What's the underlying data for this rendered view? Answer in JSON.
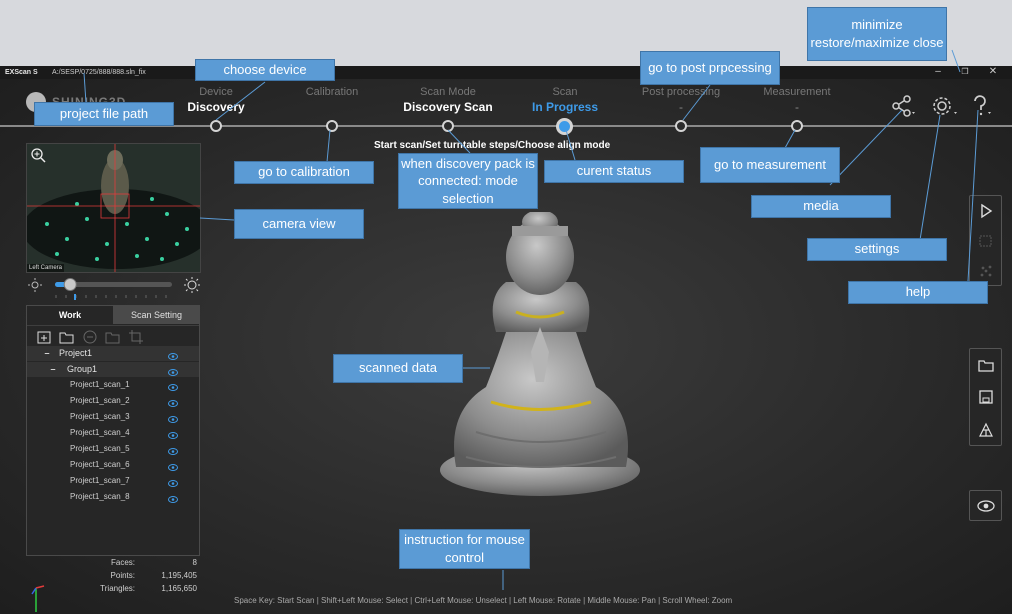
{
  "window": {
    "app_name": "EXScan S",
    "file_path": "A:/SESP/0725/888/888.sln_fix",
    "minimize": "–",
    "restore": "❐",
    "close": "✕"
  },
  "logo": {
    "text": "SHINING3D",
    "icon": "shining3d-logo-icon"
  },
  "steps": [
    {
      "title": "Device",
      "value": "Discovery"
    },
    {
      "title": "Calibration",
      "value": ""
    },
    {
      "title": "Scan Mode",
      "value": "Discovery Scan"
    },
    {
      "title": "Scan",
      "value": "In Progress"
    },
    {
      "title": "Post processing",
      "value": "-"
    },
    {
      "title": "Measurement",
      "value": "-"
    }
  ],
  "status_text": "Start scan/Set turntable steps/Choose align mode",
  "top_icons": [
    "share-icon",
    "gear-icon",
    "help-icon"
  ],
  "camera": {
    "label": "Left Camera",
    "zoom_icon": "zoom-in-icon"
  },
  "brightness": {
    "level": 0.13
  },
  "panel": {
    "tabs": [
      "Work",
      "Scan Setting"
    ],
    "tools": [
      "new-group-icon",
      "open-folder-icon",
      "remove-icon",
      "folder-icon",
      "crop-icon"
    ],
    "project": "Project1",
    "group": "Group1",
    "scans": [
      "Project1_scan_1",
      "Project1_scan_2",
      "Project1_scan_3",
      "Project1_scan_4",
      "Project1_scan_5",
      "Project1_scan_6",
      "Project1_scan_7",
      "Project1_scan_8"
    ]
  },
  "stats": [
    {
      "label": "Faces:",
      "value": "8"
    },
    {
      "label": "Points:",
      "value": "1,195,405"
    },
    {
      "label": "Triangles:",
      "value": "1,165,650"
    }
  ],
  "mouse_help": "Space Key: Start Scan | Shift+Left Mouse: Select | Ctrl+Left Mouse: Unselect | Left Mouse: Rotate | Middle Mouse: Pan | Scroll Wheel: Zoom",
  "side_buttons": [
    "play-icon",
    "crop-icon",
    "points-icon",
    "folder-icon",
    "save-icon",
    "mesh-icon",
    "eye-icon"
  ],
  "callouts": {
    "project_file_path": "project file path",
    "choose_device": "choose device",
    "go_to_calibration": "go to calibration",
    "mode_selection": "when discovery pack is connected: mode selection",
    "current_status": "curent status",
    "go_to_post_processing": "go to post prpcessing",
    "go_to_measurement": "go to measurement",
    "media": "media",
    "settings": "settings",
    "help": "help",
    "window_controls": "minimize restore/maximize close",
    "camera_view": "camera view",
    "scanned_data": "scanned data",
    "mouse_instruction": "instruction for mouse control"
  },
  "colors": {
    "accent": "#3e9be9",
    "callout": "#5b9bd5",
    "background": "#2b2b2b"
  }
}
